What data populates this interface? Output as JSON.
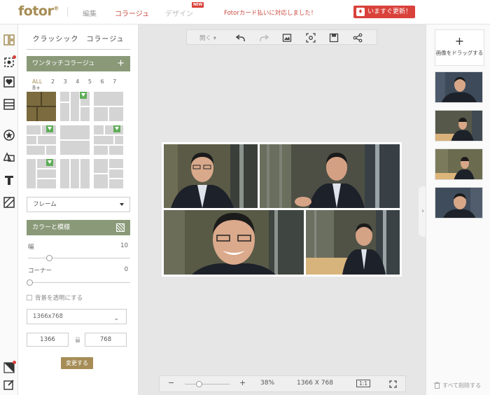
{
  "brand": {
    "logo": "fotor",
    "accent": "#a68d55",
    "red": "#d9413b"
  },
  "nav": {
    "edit": "編集",
    "collage": "コラージュ",
    "design": "デザイン",
    "new_badge": "NEW"
  },
  "notice": "Fotorカード払いに対応しました！",
  "update_button": "いますぐ更新！",
  "panel": {
    "title": "クラッシック　コラージュ",
    "one_touch": "ワンタッチコラージュ",
    "counts": [
      "ALL",
      "2",
      "3",
      "4",
      "5",
      "6",
      "7",
      "8+"
    ],
    "frame_label": "フレーム",
    "color_pattern": "カラーと模様",
    "width_label": "幅",
    "width_value": "10",
    "corner_label": "コーナー",
    "corner_value": "0",
    "transparent_bg": "背景を透明にする",
    "size_preset": "1366x768",
    "width_input": "1366",
    "height_input": "768",
    "apply_button": "変更する"
  },
  "toolbar": {
    "open": "開く"
  },
  "zoom": {
    "minus": "−",
    "plus": "+",
    "percent": "38%",
    "dims": "1366 X 768",
    "ratio": "1:1"
  },
  "right": {
    "add_image": "画像をドラッグする",
    "delete_all": "すべて削除する"
  }
}
